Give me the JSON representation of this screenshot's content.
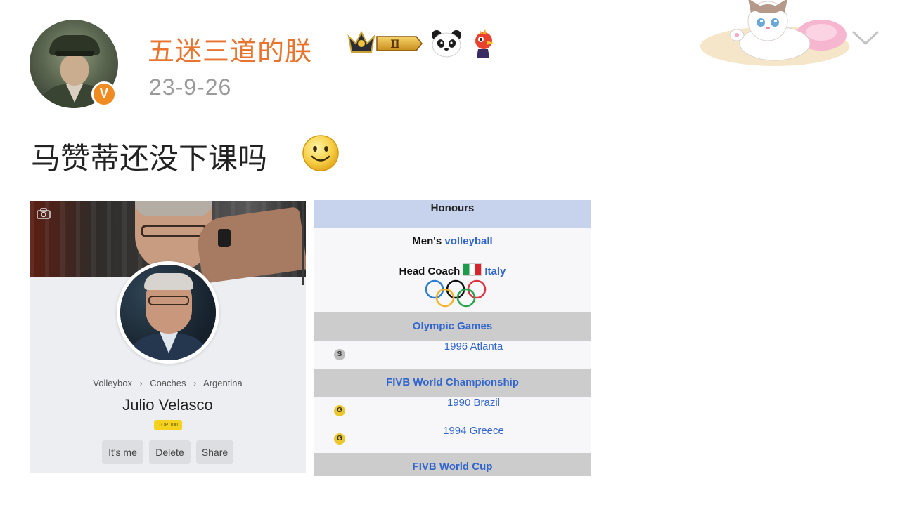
{
  "post": {
    "author": {
      "name": "五迷三道的朕",
      "verified_badge": "V",
      "badges": [
        "crown-level-icon",
        "panda-icon",
        "bird-icon"
      ],
      "crown_level": "Ⅱ"
    },
    "date": "23-9-26",
    "text": "马赞蒂还没下课吗",
    "emoji": "smile-emoji"
  },
  "profile_image": {
    "breadcrumb": [
      "Volleybox",
      "Coaches",
      "Argentina"
    ],
    "breadcrumb_separator": "›",
    "name": "Julio Velasco",
    "rank_badge": "TOP 100",
    "buttons": [
      "It's me",
      "Delete",
      "Share"
    ]
  },
  "honours_image": {
    "header": "Honours",
    "sport_prefix": "Men's",
    "sport_link": "volleyball",
    "coach_role": "Head Coach",
    "country": "Italy",
    "sections": [
      {
        "title": "Olympic Games",
        "rows": [
          {
            "medal": "S",
            "event": "1996 Atlanta"
          }
        ]
      },
      {
        "title": "FIVB World Championship",
        "rows": [
          {
            "medal": "G",
            "event": "1990 Brazil"
          },
          {
            "medal": "G",
            "event": "1994 Greece"
          }
        ]
      },
      {
        "title": "FIVB World Cup",
        "rows": []
      }
    ]
  },
  "colors": {
    "username": "#e8752f",
    "verified": "#f08b22",
    "date": "#9a9a9a",
    "link": "#3366cc",
    "honours_header": "#c7d2ec",
    "section_bg": "#cccccc",
    "gold": "#ecc72c",
    "silver": "#bdbdbd"
  }
}
